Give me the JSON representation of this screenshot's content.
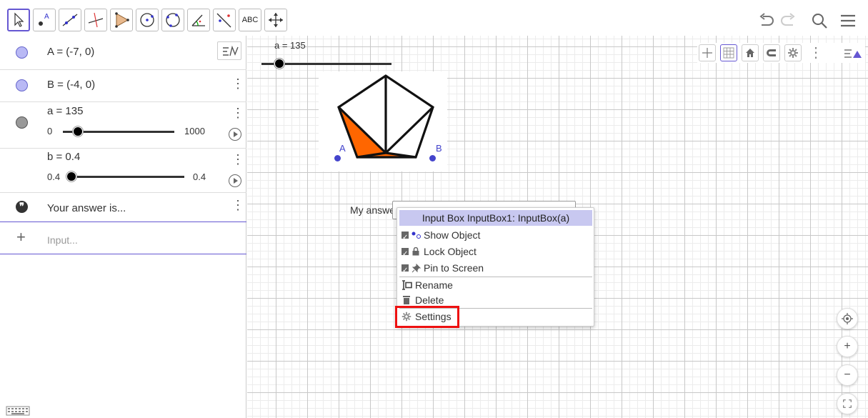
{
  "toolbar": {
    "tools": [
      {
        "name": "move-tool",
        "label": ""
      },
      {
        "name": "point-tool",
        "label": "A"
      },
      {
        "name": "line-tool",
        "label": ""
      },
      {
        "name": "perpendicular-tool",
        "label": ""
      },
      {
        "name": "polygon-tool",
        "label": ""
      },
      {
        "name": "circle-center-tool",
        "label": ""
      },
      {
        "name": "circle-three-points-tool",
        "label": ""
      },
      {
        "name": "angle-tool",
        "label": ""
      },
      {
        "name": "reflect-tool",
        "label": ""
      },
      {
        "name": "text-tool",
        "label": "ABC"
      },
      {
        "name": "move-graphics-tool",
        "label": ""
      }
    ],
    "undo_icon": "undo-icon",
    "redo_icon": "redo-icon",
    "search_icon": "search-icon",
    "menu_icon": "menu-icon"
  },
  "algebra": {
    "rows": [
      {
        "text": "A = (-7, 0)",
        "marble_color": "#b9b9f5"
      },
      {
        "text": "B = (-4, 0)",
        "marble_color": "#b9b9f5"
      },
      {
        "text": "a = 135",
        "marble_color": "#999999",
        "slider_min": "0",
        "slider_max": "1000",
        "slider_value": 0.135
      },
      {
        "text": "b = 0.4",
        "slider_min": "0.4",
        "slider_max": "0.4",
        "slider_value": 0.0
      },
      {
        "text": "Your answer is...",
        "marble_icon": "quote-icon"
      }
    ],
    "input_placeholder": "Input...",
    "add_icon": "plus-icon"
  },
  "graphics": {
    "slider_label": "a = 135",
    "slider_value": 0.135,
    "point_a_label": "A",
    "point_b_label": "B",
    "input_label": "My answe",
    "pentagon_fill": "#ff6600"
  },
  "context_menu": {
    "title": "Input Box InputBox1: InputBox(a)",
    "items": {
      "show_object": "Show Object",
      "lock_object": "Lock Object",
      "pin_to_screen": "Pin to Screen",
      "rename": "Rename",
      "delete": "Delete",
      "settings": "Settings"
    },
    "highlight_color": "#e11111"
  },
  "style_bar": {
    "buttons": [
      "axes-icon",
      "grid-icon",
      "home-icon",
      "magnet-icon",
      "settings-icon",
      "more-icon",
      "toggle-style-bar-icon"
    ]
  },
  "zoom": {
    "buttons": [
      "recenter-icon",
      "zoom-in-icon",
      "zoom-out-icon",
      "fullscreen-icon"
    ]
  },
  "colors": {
    "accent": "#6557d2",
    "menu_title_bg": "#c8c8f0",
    "point_color": "#4444cc"
  }
}
